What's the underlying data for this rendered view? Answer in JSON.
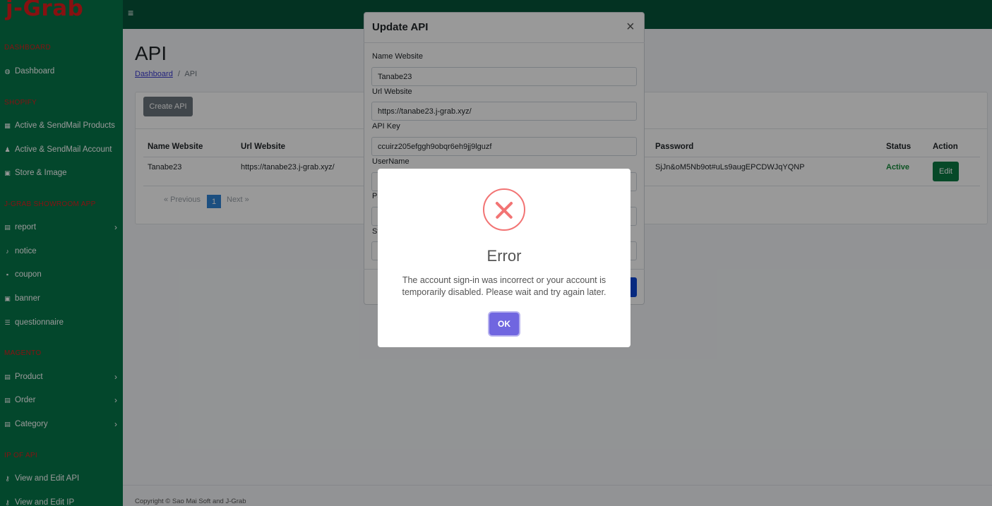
{
  "app": {
    "brand": "j-Grab"
  },
  "sidebar": {
    "sections": [
      {
        "title": "DASHBOARD"
      },
      {
        "title": "SHOPIFY"
      },
      {
        "title": "J-GRAB SHOWROOM APP"
      },
      {
        "title": "MAGENTO"
      },
      {
        "title": "IP OF API"
      }
    ],
    "items": [
      {
        "label": "Dashboard",
        "icon": "gauge-icon"
      },
      {
        "label": "Active & SendMail Products",
        "icon": "calendar-icon"
      },
      {
        "label": "Active & SendMail Account",
        "icon": "user-icon"
      },
      {
        "label": "Store & Image",
        "icon": "image-icon"
      },
      {
        "label": "report",
        "icon": "table-icon",
        "chevron": "›"
      },
      {
        "label": "notice",
        "icon": "bell-icon"
      },
      {
        "label": "coupon",
        "icon": "ticket-icon"
      },
      {
        "label": "banner",
        "icon": "image-icon"
      },
      {
        "label": "questionnaire",
        "icon": "list-icon"
      },
      {
        "label": "Product",
        "icon": "table-icon",
        "chevron": "›"
      },
      {
        "label": "Order",
        "icon": "table-icon",
        "chevron": "›"
      },
      {
        "label": "Category",
        "icon": "table-icon",
        "chevron": "›"
      },
      {
        "label": "View and Edit API",
        "icon": "key-icon"
      },
      {
        "label": "View and Edit IP",
        "icon": "key-icon"
      }
    ]
  },
  "topbar": {
    "menu_icon": "≡"
  },
  "page": {
    "title": "API",
    "breadcrumb": {
      "home": "Dashboard",
      "separator": "/",
      "current": "API"
    }
  },
  "card": {
    "create_button": "Create API",
    "columns": [
      "Name Website",
      "Url Website",
      "Password",
      "Status",
      "Action"
    ],
    "rows": [
      {
        "name": "Tanabe23",
        "url": "https://tanabe23.j-grab.xyz/",
        "password": "SjJn&oM5Nb9ot#uLs9augEPCDWJqYQNP",
        "status": "Active",
        "action": "Edit"
      }
    ],
    "pagination": {
      "previous": "« Previous",
      "current": "1",
      "next": "Next »"
    }
  },
  "footer": {
    "text": "Copyright © Sao Mai Soft and J-Grab"
  },
  "modal": {
    "title": "Update API",
    "close": "×",
    "fields": [
      {
        "label": "Name Website",
        "value": "Tanabe23"
      },
      {
        "label": "Url Website",
        "value": "https://tanabe23.j-grab.xyz/"
      },
      {
        "label": "API Key",
        "value": "ccuirz205efggh9obqr6eh9jj9lguzf"
      },
      {
        "label": "UserName",
        "value": ""
      },
      {
        "label": "Pa",
        "value": ""
      },
      {
        "label": "St",
        "value": ""
      }
    ]
  },
  "alert": {
    "icon": "error-x-icon",
    "title": "Error",
    "message": "The account sign-in was incorrect or your account is temporarily disabled. Please wait and try again later.",
    "ok_label": "OK"
  },
  "colors": {
    "sidebar_bg": "#06774a",
    "topbar_bg": "#06543a",
    "brand_red": "#e11d1d",
    "alert_error": "#f27474",
    "confirm_button": "#7066e0",
    "status_active": "#168c3c"
  }
}
